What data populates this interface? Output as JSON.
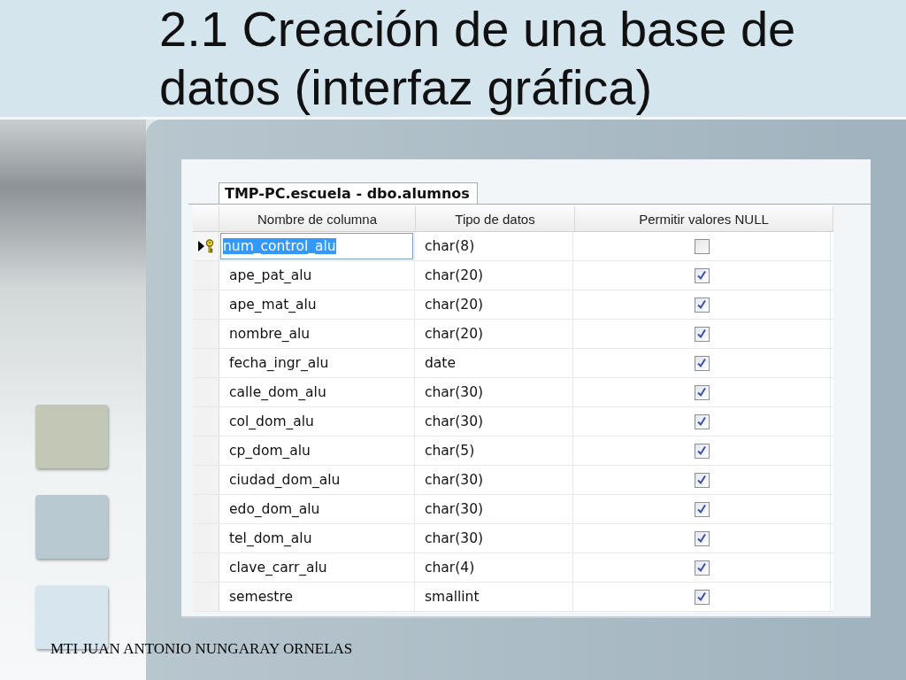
{
  "slide": {
    "title": "2.1 Creación de una base de datos (interfaz gráfica)",
    "footer": "MTI JUAN ANTONIO NUNGARAY ORNELAS"
  },
  "designer": {
    "tab": {
      "label": "TMP-PC.escuela - dbo.alumnos",
      "selected": true
    },
    "columns": [
      "Nombre de columna",
      "Tipo de datos",
      "Permitir valores NULL"
    ],
    "rows": [
      {
        "name": "num_control_alu",
        "type": "char(8)",
        "allow_null": false,
        "primary_key": true,
        "current": true
      },
      {
        "name": "ape_pat_alu",
        "type": "char(20)",
        "allow_null": true,
        "primary_key": false,
        "current": false
      },
      {
        "name": "ape_mat_alu",
        "type": "char(20)",
        "allow_null": true,
        "primary_key": false,
        "current": false
      },
      {
        "name": "nombre_alu",
        "type": "char(20)",
        "allow_null": true,
        "primary_key": false,
        "current": false
      },
      {
        "name": "fecha_ingr_alu",
        "type": "date",
        "allow_null": true,
        "primary_key": false,
        "current": false
      },
      {
        "name": "calle_dom_alu",
        "type": "char(30)",
        "allow_null": true,
        "primary_key": false,
        "current": false
      },
      {
        "name": "col_dom_alu",
        "type": "char(30)",
        "allow_null": true,
        "primary_key": false,
        "current": false
      },
      {
        "name": "cp_dom_alu",
        "type": "char(5)",
        "allow_null": true,
        "primary_key": false,
        "current": false
      },
      {
        "name": "ciudad_dom_alu",
        "type": "char(30)",
        "allow_null": true,
        "primary_key": false,
        "current": false
      },
      {
        "name": "edo_dom_alu",
        "type": "char(30)",
        "allow_null": true,
        "primary_key": false,
        "current": false
      },
      {
        "name": "tel_dom_alu",
        "type": "char(30)",
        "allow_null": true,
        "primary_key": false,
        "current": false
      },
      {
        "name": "clave_carr_alu",
        "type": "char(4)",
        "allow_null": true,
        "primary_key": false,
        "current": false
      },
      {
        "name": "semestre",
        "type": "smallint",
        "allow_null": true,
        "primary_key": false,
        "current": false
      }
    ]
  }
}
